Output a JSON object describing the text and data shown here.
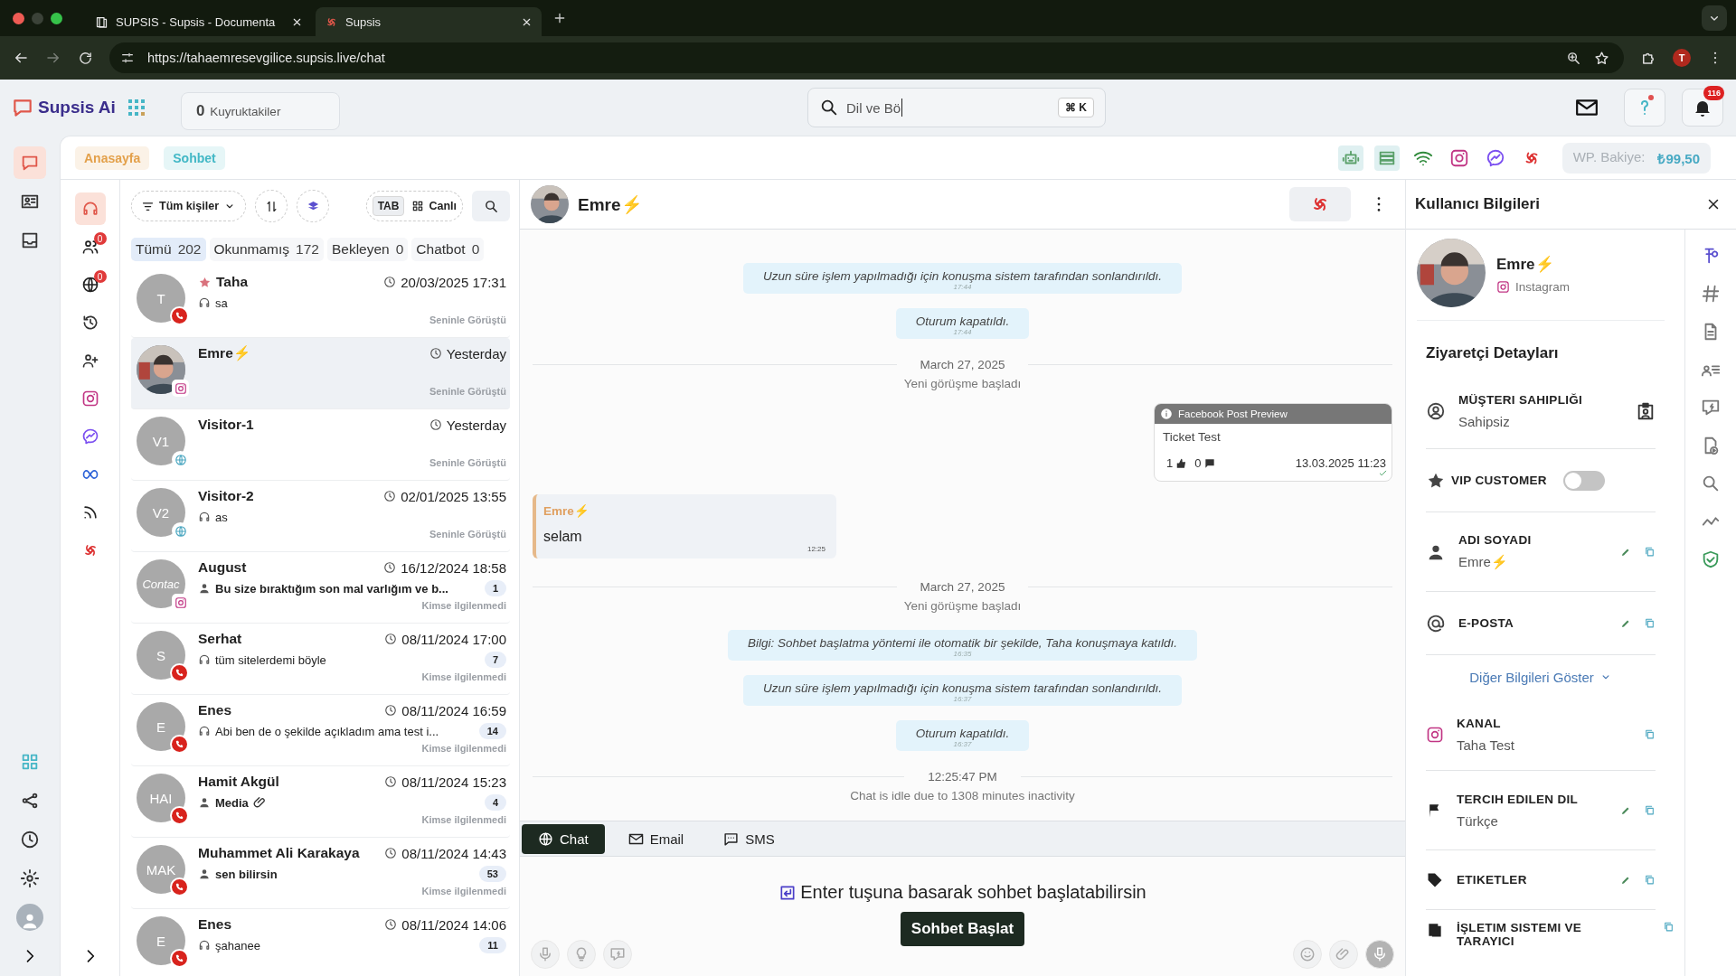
{
  "browser": {
    "tabs": [
      {
        "title": "SUPSIS - Supsis - Documenta",
        "selected": false
      },
      {
        "title": "Supsis",
        "selected": true
      }
    ],
    "url": "https://tahaemresevgilice.supsis.live/chat",
    "profile": "T"
  },
  "header": {
    "logo": "Supsis Ai",
    "queue": {
      "count": "0",
      "label": "Kuyruktakiler"
    },
    "search": {
      "value": "Dil ve Bö",
      "shortcut": "⌘ K"
    },
    "notifications": "116"
  },
  "rail": [
    {
      "selected": true
    },
    {
      "selected": false
    },
    {
      "selected": false
    }
  ],
  "breadcrumbs": [
    {
      "label": "Anasayfa",
      "color": "#e3a04a"
    },
    {
      "label": "Sohbet",
      "color": "#43b8c6"
    }
  ],
  "balance": {
    "label": "WP. Bakiye:",
    "amount": "₺99,50"
  },
  "inbox_rail": [
    {
      "selected": true
    },
    {
      "selected": false,
      "badge": "0"
    },
    {
      "selected": false,
      "badge": "0"
    },
    {
      "selected": false
    },
    {
      "selected": false
    },
    {
      "selected": false
    },
    {
      "selected": false
    },
    {
      "selected": false
    },
    {
      "selected": false
    },
    {
      "selected": false
    }
  ],
  "filters": {
    "contacts": "Tüm kişiler",
    "tab": "TAB",
    "live": "Canlı"
  },
  "tabs": [
    {
      "label": "Tümü",
      "count": "202",
      "selected": true
    },
    {
      "label": "Okunmamış",
      "count": "172",
      "selected": false
    },
    {
      "label": "Bekleyen",
      "count": "0",
      "selected": false
    },
    {
      "label": "Chatbot",
      "count": "0",
      "selected": false
    }
  ],
  "conversations": [
    {
      "name": "Taha",
      "starred": true,
      "time": "20/03/2025 17:31",
      "preview": {
        "kind": "agent",
        "text": "sa"
      },
      "attachment": false,
      "status": "Seninle Görüştü",
      "avatar": {
        "kind": "initials",
        "text": "T"
      },
      "badge": {
        "kind": "whatsapp"
      },
      "selected": false
    },
    {
      "name": "Emre⚡",
      "starred": false,
      "time": "Yesterday",
      "attachment": false,
      "status": "Seninle Görüştü",
      "badge": {
        "kind": "instagram"
      },
      "selected": true
    },
    {
      "name": "Visitor-1",
      "starred": false,
      "time": "Yesterday",
      "attachment": false,
      "status": "Seninle Görüştü",
      "avatar": {
        "kind": "initials",
        "text": "V1"
      },
      "badge": {
        "kind": "web"
      },
      "selected": false
    },
    {
      "name": "Visitor-2",
      "starred": false,
      "time": "02/01/2025 13:55",
      "preview": {
        "kind": "agent",
        "text": "as"
      },
      "attachment": false,
      "status": "Seninle Görüştü",
      "avatar": {
        "kind": "initials",
        "text": "V2"
      },
      "badge": {
        "kind": "web"
      },
      "selected": false
    },
    {
      "name": "August",
      "starred": false,
      "time": "16/12/2024 18:58",
      "preview": {
        "kind": "customer",
        "text": "Bu size bıraktığım son mal varlığım ve b..."
      },
      "attachment": false,
      "count": "1",
      "status": "Kimse ilgilenmedi",
      "avatar": {
        "kind": "broken",
        "text": "Contac"
      },
      "badge": {
        "kind": "instagram"
      },
      "selected": false
    },
    {
      "name": "Serhat",
      "starred": false,
      "time": "08/11/2024 17:00",
      "preview": {
        "kind": "agent",
        "text": "tüm sitelerdemi böyle"
      },
      "attachment": false,
      "count": "7",
      "status": "Kimse ilgilenmedi",
      "avatar": {
        "kind": "initials",
        "text": "S"
      },
      "badge": {
        "kind": "whatsapp"
      },
      "selected": false
    },
    {
      "name": "Enes",
      "starred": false,
      "time": "08/11/2024 16:59",
      "preview": {
        "kind": "agent",
        "text": "Abi ben de o şekilde açıkladım ama test i..."
      },
      "attachment": false,
      "count": "14",
      "status": "Kimse ilgilenmedi",
      "avatar": {
        "kind": "initials",
        "text": "E"
      },
      "badge": {
        "kind": "whatsapp"
      },
      "selected": false
    },
    {
      "name": "Hamit Akgül",
      "starred": false,
      "time": "08/11/2024 15:23",
      "preview": {
        "kind": "customer",
        "text": "Media"
      },
      "attachment": true,
      "count": "4",
      "status": "Kimse ilgilenmedi",
      "avatar": {
        "kind": "initials",
        "text": "HAI"
      },
      "badge": {
        "kind": "whatsapp"
      },
      "selected": false
    },
    {
      "name": "Muhammet Ali Karakaya",
      "starred": false,
      "time": "08/11/2024 14:43",
      "preview": {
        "kind": "customer",
        "text": "sen bilirsin"
      },
      "attachment": false,
      "count": "53",
      "status": "Kimse ilgilenmedi",
      "avatar": {
        "kind": "initials",
        "text": "MAK"
      },
      "badge": {
        "kind": "whatsapp"
      },
      "selected": false
    },
    {
      "name": "Enes",
      "starred": false,
      "time": "08/11/2024 14:06",
      "preview": {
        "kind": "agent",
        "text": "şahanee"
      },
      "attachment": false,
      "count": "11",
      "avatar": {
        "kind": "initials",
        "text": "E"
      },
      "badge": {
        "kind": "whatsapp"
      },
      "selected": false
    }
  ],
  "chat": {
    "name": "Emre⚡",
    "messages": [
      {
        "kind": "system",
        "text": "Uzun süre işlem yapılmadığı için konuşma sistem tarafından sonlandırıldı.",
        "time": "17:44"
      },
      {
        "kind": "system",
        "text": "Oturum kapatıldı.",
        "time": "17:44"
      },
      {
        "kind": "date",
        "text": "March 27, 2025"
      },
      {
        "kind": "notice",
        "text": "Yeni görüşme başladı"
      },
      {
        "kind": "post",
        "header": "Facebook Post Preview",
        "title": "Ticket Test",
        "likes": "1",
        "comments": "0",
        "time": "13.03.2025 11:23"
      },
      {
        "kind": "incoming",
        "author": "Emre⚡",
        "text": "selam",
        "time": "12:25"
      },
      {
        "kind": "date",
        "text": "March 27, 2025"
      },
      {
        "kind": "notice",
        "text": "Yeni görüşme başladı"
      },
      {
        "kind": "system",
        "text": "Bilgi: Sohbet başlatma yöntemi ile otomatik bir şekilde, Taha konuşmaya katıldı.",
        "time": "16:35"
      },
      {
        "kind": "system",
        "text": "Uzun süre işlem yapılmadığı için konuşma sistem tarafından sonlandırıldı.",
        "time": "16:37"
      },
      {
        "kind": "system",
        "text": "Oturum kapatıldı.",
        "time": "16:37"
      },
      {
        "kind": "date",
        "text": "12:25:47 PM"
      },
      {
        "kind": "notice",
        "text": "Chat is idle due to 1308 minutes inactivity"
      }
    ]
  },
  "composer": {
    "tabs": [
      {
        "label": "Chat",
        "selected": true
      },
      {
        "label": "Email",
        "selected": false
      },
      {
        "label": "SMS",
        "selected": false
      }
    ],
    "hint": "Enter tuşuna basarak sohbet başlatabilirsin",
    "button": "Sohbet Başlat"
  },
  "profile_panel": {
    "title": "Kullanıcı Bilgileri",
    "name": "Emre⚡",
    "channel": "Instagram",
    "section": "Ziyaretçi Detayları",
    "fields": [
      {
        "kind": "owner",
        "label": "MÜŞTERI SAHIPLIĞI",
        "value": "Sahipsiz"
      },
      {
        "kind": "toggle",
        "label": "VIP CUSTOMER",
        "on": false
      },
      {
        "kind": "name",
        "label": "ADI SOYADI",
        "value": "Emre⚡",
        "editable": true
      },
      {
        "kind": "email",
        "label": "E-POSTA",
        "editable": true
      }
    ],
    "more": "Diğer Bilgileri Göster",
    "more_fields": [
      {
        "kind": "channel",
        "label": "KANAL",
        "value": "Taha Test",
        "editable": false
      },
      {
        "kind": "language",
        "label": "TERCIH EDILEN DIL",
        "value": "Türkçe",
        "editable": true
      },
      {
        "kind": "tags",
        "label": "ETIKETLER",
        "editable": true
      },
      {
        "kind": "os",
        "label": "İŞLETIM SISTEMI VE TARAYICI",
        "editable": false
      }
    ]
  }
}
